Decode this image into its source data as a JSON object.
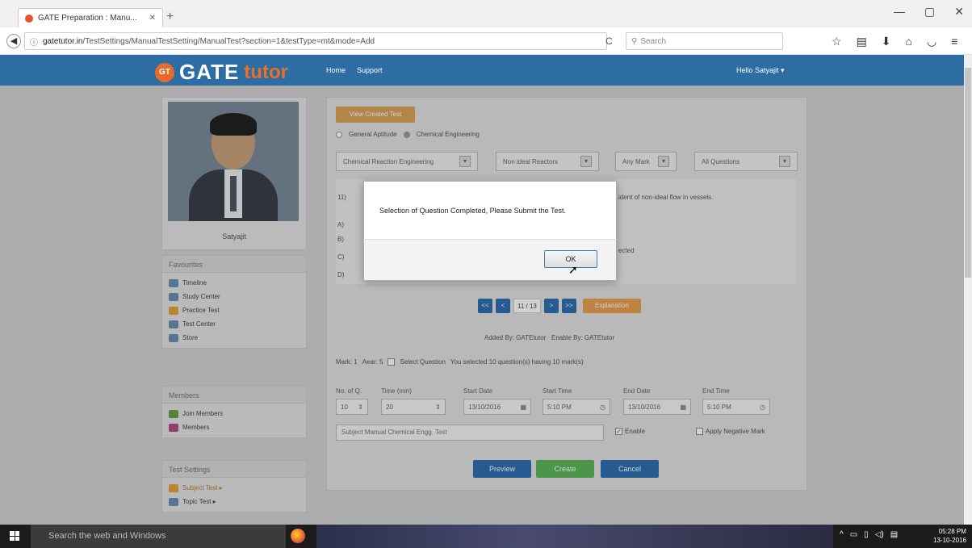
{
  "browser": {
    "tab_title": "GATE Preparation : Manu...",
    "new_tab": "+",
    "window_controls": [
      "—",
      "▢",
      "✕"
    ],
    "url_host": "gatetutor.in",
    "url_path": "/TestSettings/ManualTestSetting/ManualTest?section=1&testType=mt&mode=Add",
    "reload": "C",
    "search_placeholder": "Search",
    "toolbar_icons": [
      "star-icon",
      "reading-list-icon",
      "download-icon",
      "home-icon",
      "pocket-icon",
      "menu-icon"
    ]
  },
  "site": {
    "logo_badge": "GT",
    "logo_gate": "GATE",
    "logo_tutor": "tutor",
    "nav": [
      "Home",
      "Support"
    ],
    "user_greeting": "Hello Satyajit ▾"
  },
  "sidebar": {
    "name": "Satyajit",
    "favourites_title": "Favourites",
    "favourites": [
      "Timeline",
      "Study Center",
      "Practice Test",
      "Test Center",
      "Store"
    ],
    "members_title": "Members",
    "members": [
      "Join Members",
      "Members"
    ],
    "settings_title": "Test Settings",
    "settings": [
      "Subject Test ▸",
      "Topic Test ▸"
    ]
  },
  "main": {
    "view_button": "View Created Test",
    "radio_general": "General Aptitude",
    "radio_chemical": "Chemical Engineering",
    "select_subject": "Chemical Reaction Engineering",
    "select_topic": "Non ideal Reactors",
    "select_mark": "Any Mark",
    "select_questions": "All Questions",
    "question_number": "11)",
    "question_text_tail": "ident of non-ideal flow in vessels.",
    "option_a": "A)",
    "option_b": "B)",
    "option_c": "C)",
    "option_d": "D)",
    "option_b_tail": "ected",
    "pager": [
      "<<",
      "<",
      ">",
      ">>"
    ],
    "page_indicator": "11 / 13",
    "explanation_button": "Explanation",
    "added_by": "Added By: GATEtutor",
    "enable_by": "Enable By: GATEtutor",
    "mark_label": "Mark: 1",
    "aear_label": "Aear: 5",
    "select_question_label": "Select Question",
    "selected_info": "You selected 10 question(s) having 10 mark(s)",
    "field_labels": [
      "No. of Q.",
      "Time (min)",
      "Start Date",
      "Start Time",
      "End Date",
      "End Time"
    ],
    "no_of_q": "10",
    "time_min": "20",
    "start_date": "13/10/2016",
    "start_time": "5:10 PM",
    "end_date": "13/10/2016",
    "end_time": "5:10 PM",
    "test_name": "Subject Manual Chemical Engg. Test",
    "enable_label": "Enable",
    "negative_label": "Apply Negative Mark",
    "preview_button": "Preview",
    "create_button": "Create",
    "cancel_button": "Cancel"
  },
  "modal": {
    "message": "Selection of Question Completed, Please Submit the Test.",
    "ok_button": "OK"
  },
  "taskbar": {
    "search_placeholder": "Search the web and Windows",
    "time": "05:28 PM",
    "date": "13-10-2016"
  },
  "colors": {
    "header_blue": "#2e6da4",
    "button_blue": "#2f6fb3",
    "button_orange": "#d9a35a",
    "button_green": "#5cb85c"
  }
}
